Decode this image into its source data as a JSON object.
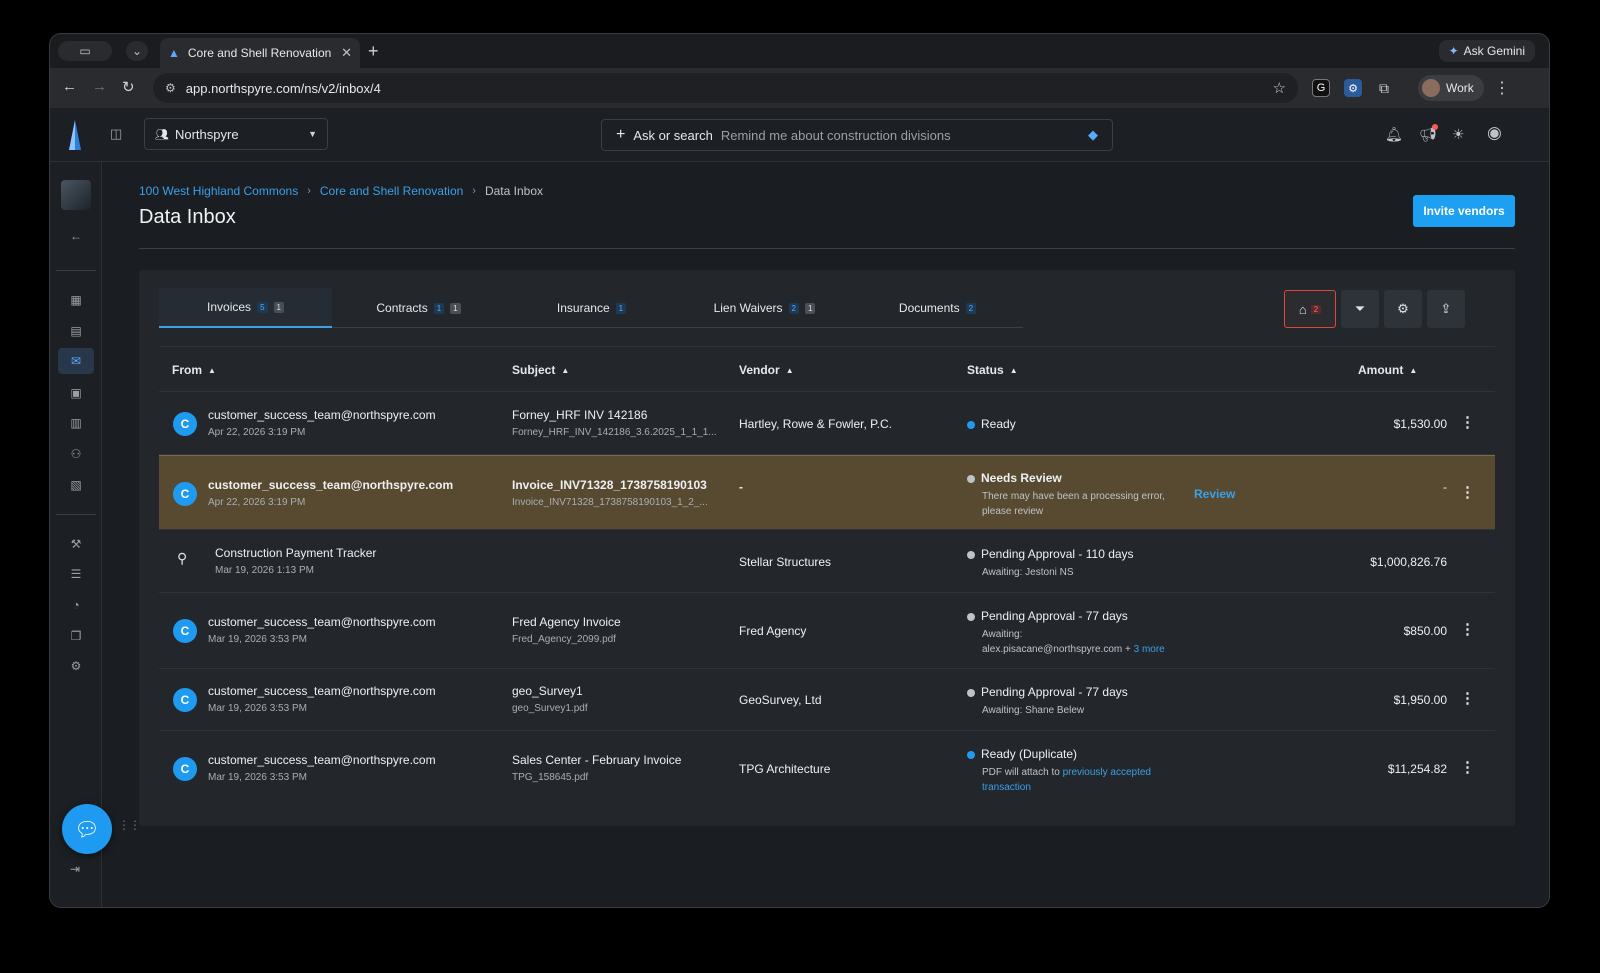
{
  "browser": {
    "tab_title": "Core and Shell Renovation | D",
    "tab_close": "✕",
    "new_tab": "+",
    "url": "app.northspyre.com/ns/v2/inbox/4",
    "ask_gemini": "Ask Gemini",
    "profile": "Work"
  },
  "topbar": {
    "project": "Northspyre",
    "ask_lead": "Ask or search",
    "ask_hint": "Remind me about construction divisions"
  },
  "breadcrumb": [
    "100 West Highland Commons",
    "Core and Shell Renovation",
    "Data Inbox"
  ],
  "page_title": "Data Inbox",
  "invite_label": "Invite vendors",
  "tabs": [
    {
      "label": "Invoices",
      "blue": "5",
      "gray": "1"
    },
    {
      "label": "Contracts",
      "blue": "1",
      "gray": "1"
    },
    {
      "label": "Insurance",
      "blue": "1",
      "gray": ""
    },
    {
      "label": "Lien Waivers",
      "blue": "2",
      "gray": "1"
    },
    {
      "label": "Documents",
      "blue": "2",
      "gray": ""
    }
  ],
  "vendor_filter_count": "2",
  "columns": {
    "from": "From",
    "subject": "Subject",
    "vendor": "Vendor",
    "status": "Status",
    "amount": "Amount"
  },
  "rows": [
    {
      "avatar": "C",
      "from": "customer_success_team@northspyre.com",
      "date": "Apr 22, 2026 3:19 PM",
      "subject": "Forney_HRF INV 142186",
      "file": "Forney_HRF_INV_142186_3.6.2025_1_1_1...",
      "vendor": "Hartley, Rowe & Fowler, P.C.",
      "status": "Ready",
      "status_sub": "",
      "amount": "$1,530.00"
    },
    {
      "avatar": "C",
      "from": "customer_success_team@northspyre.com",
      "date": "Apr 22, 2026 3:19 PM",
      "subject": "Invoice_INV71328_1738758190103",
      "file": "Invoice_INV71328_1738758190103_1_2_...",
      "vendor": "-",
      "status": "Needs Review",
      "status_sub": "There may have been a processing error, please review",
      "review": "Review",
      "amount": "-"
    },
    {
      "avatar": "",
      "from": "Construction Payment Tracker",
      "date": "Mar 19, 2026 1:13 PM",
      "subject": "",
      "file": "",
      "vendor": "Stellar Structures",
      "status": "Pending Approval - 110 days",
      "status_sub": "Awaiting: Jestoni NS",
      "amount": "$1,000,826.76"
    },
    {
      "avatar": "C",
      "from": "customer_success_team@northspyre.com",
      "date": "Mar 19, 2026 3:53 PM",
      "subject": "Fred Agency Invoice",
      "file": "Fred_Agency_2099.pdf",
      "vendor": "Fred Agency",
      "status": "Pending Approval - 77 days",
      "status_sub": "Awaiting:",
      "status_sub2": "alex.pisacane@northspyre.com +",
      "status_link": "3 more",
      "amount": "$850.00"
    },
    {
      "avatar": "C",
      "from": "customer_success_team@northspyre.com",
      "date": "Mar 19, 2026 3:53 PM",
      "subject": "geo_Survey1",
      "file": "geo_Survey1.pdf",
      "vendor": "GeoSurvey, Ltd",
      "status": "Pending Approval - 77 days",
      "status_sub": "Awaiting: Shane Belew",
      "amount": "$1,950.00"
    },
    {
      "avatar": "C",
      "from": "customer_success_team@northspyre.com",
      "date": "Mar 19, 2026 3:53 PM",
      "subject": "Sales Center - February Invoice",
      "file": "TPG_158645.pdf",
      "vendor": "TPG Architecture",
      "status": "Ready (Duplicate)",
      "status_sub": "PDF will attach to",
      "status_link": "previously accepted transaction",
      "amount": "$11,254.82"
    }
  ],
  "colors": {
    "accent": "#1ea0f2",
    "ready": "#1e9bf0",
    "pending": "#bfc3c7",
    "highlight_row": "#584a30"
  }
}
